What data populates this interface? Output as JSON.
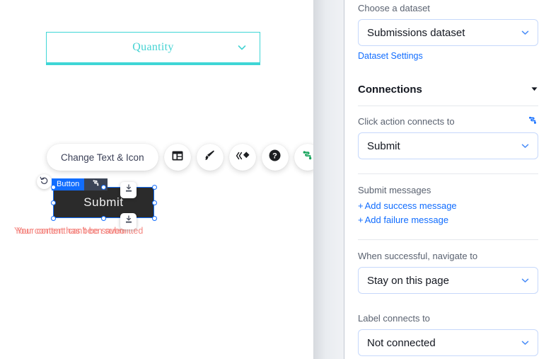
{
  "canvas": {
    "quantity_dropdown": {
      "label": "Quantity",
      "chevron_icon": "chevron-down-icon"
    },
    "toolbar": {
      "change_text_icon_label": "Change Text & Icon",
      "icons": [
        {
          "name": "layout-icon"
        },
        {
          "name": "brush-icon"
        },
        {
          "name": "animation-icon"
        },
        {
          "name": "help-icon"
        },
        {
          "name": "connect-to-data-icon"
        }
      ]
    },
    "selection": {
      "undo_icon": "undo-icon",
      "tag_label": "Button",
      "tag_connect_icon": "connect-to-data-icon",
      "button_text": "Submit",
      "import_icon": "import-icon",
      "messages": [
        "Your content has been submitted",
        "Your content can't be saved"
      ],
      "tag_color": "#116dff",
      "button_fill": "#2b2b2b",
      "message_color": "#f4857f"
    }
  },
  "panel": {
    "dataset": {
      "label": "Choose a dataset",
      "value": "Submissions dataset",
      "chevron_icon": "chevron-down-icon",
      "settings_link": "Dataset Settings"
    },
    "connections": {
      "title": "Connections",
      "collapse_icon": "triangle-down-icon"
    },
    "click_action": {
      "label": "Click action connects to",
      "connect_icon": "connect-to-data-icon",
      "value": "Submit",
      "chevron_icon": "chevron-down-icon"
    },
    "submit_messages": {
      "label": "Submit messages",
      "add_success": "Add success message",
      "add_failure": "Add failure message",
      "plus": "+"
    },
    "navigate": {
      "label": "When successful, navigate to",
      "value": "Stay on this page",
      "chevron_icon": "chevron-down-icon"
    },
    "label_connects": {
      "label": "Label connects to",
      "value": "Not connected",
      "chevron_icon": "chevron-down-icon"
    },
    "accent_color": "#116dff",
    "border_color": "#c6d8fb"
  }
}
